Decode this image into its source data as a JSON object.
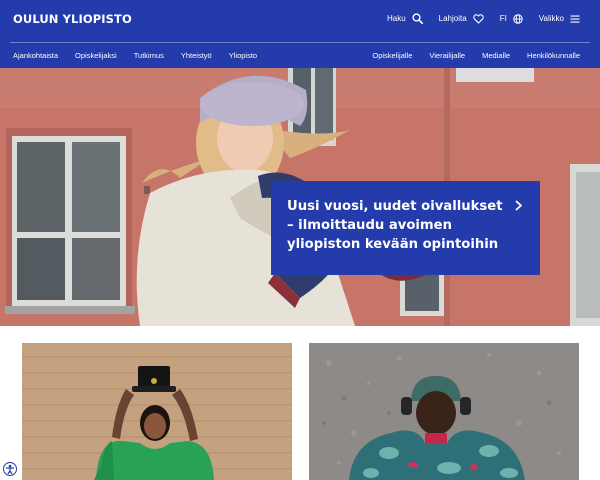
{
  "brand": {
    "logo_text": "OULUN YLIOPISTO"
  },
  "top_actions": {
    "search_label": "Haku",
    "donate_label": "Lahjoita",
    "language_label": "FI",
    "menu_label": "Valikko"
  },
  "nav": {
    "primary": [
      "Ajankohtaista",
      "Opiskelijaksi",
      "Tutkimus",
      "Yhteistyö",
      "Yliopisto"
    ],
    "audiences": [
      "Opiskelijalle",
      "Vierailijalle",
      "Medialle",
      "Henkilökunnalle"
    ]
  },
  "hero": {
    "headline": "Uusi vuosi, uudet oivallukset – ilmoittaudu avoimen yliopiston kevään opintoihin"
  },
  "colors": {
    "brand_blue": "#233bab",
    "hero_wall": "#c77569",
    "white": "#ffffff"
  },
  "icons": [
    "search-icon",
    "heart-icon",
    "globe-icon",
    "menu-icon",
    "chevron-right-icon",
    "accessibility-icon"
  ]
}
